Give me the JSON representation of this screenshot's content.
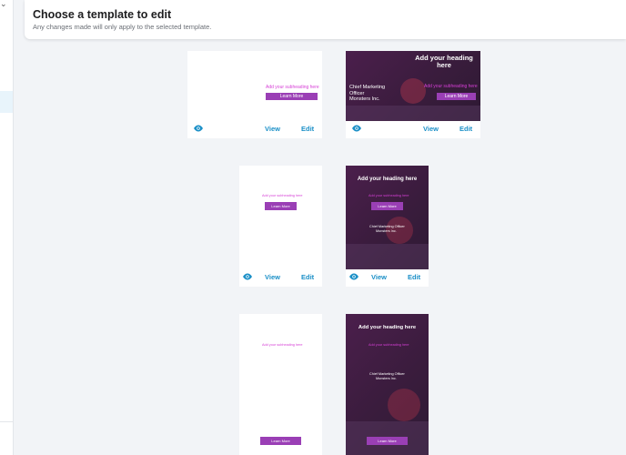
{
  "header": {
    "title": "Choose a template to edit",
    "subtitle": "Any changes made will only apply to the selected template."
  },
  "template": {
    "heading": "Add your heading here",
    "subheading": "Add your subheading here",
    "button": "Learn More",
    "body_line1": "Chief Marketing Officer",
    "body_line2": "Monsters Inc."
  },
  "actions": {
    "view": "View",
    "edit": "Edit",
    "view_icon": "eye-icon"
  },
  "colors": {
    "accent_purple": "#9a3fb5",
    "subheading_pink": "#d63fd6",
    "action_blue": "#1a8fc7",
    "dark_bg": "#3a1c3d"
  }
}
